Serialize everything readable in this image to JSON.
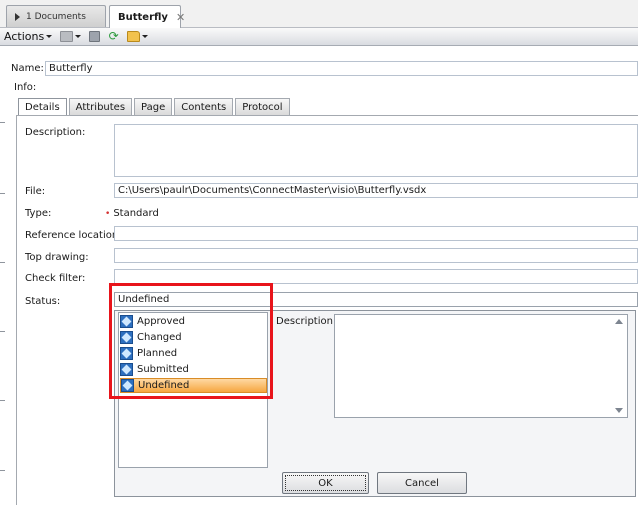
{
  "tabs": {
    "documents_label": "1 Documents",
    "active_label": "Butterfly",
    "close_glyph": "✕"
  },
  "toolbar": {
    "actions_label": "Actions",
    "icons": [
      "print-icon",
      "save-icon",
      "refresh-icon",
      "open-folder-icon"
    ]
  },
  "form": {
    "name_label": "Name:",
    "name_value": "Butterfly",
    "info_label": "Info:",
    "subtabs": [
      "Details",
      "Attributes",
      "Page",
      "Contents",
      "Protocol"
    ],
    "active_subtab": "Details",
    "description_label": "Description:",
    "file_label": "File:",
    "file_value": "C:\\Users\\paulr\\Documents\\ConnectMaster\\visio\\Butterfly.vsdx",
    "type_label": "Type:",
    "type_marker": "•",
    "type_value": "Standard",
    "reference_label": "Reference location:",
    "top_drawing_label": "Top drawing:",
    "check_filter_label": "Check filter:",
    "status_label": "Status:",
    "status_value": "Undefined"
  },
  "status_dropdown": {
    "options": [
      "Approved",
      "Changed",
      "Planned",
      "Submitted",
      "Undefined"
    ],
    "selected": "Undefined",
    "description_label": "Description:",
    "ok_label": "OK",
    "cancel_label": "Cancel"
  },
  "colors": {
    "highlight_border": "#e8141b",
    "selected_option": "#f6a640",
    "option_icon": "#2d6fbf"
  }
}
